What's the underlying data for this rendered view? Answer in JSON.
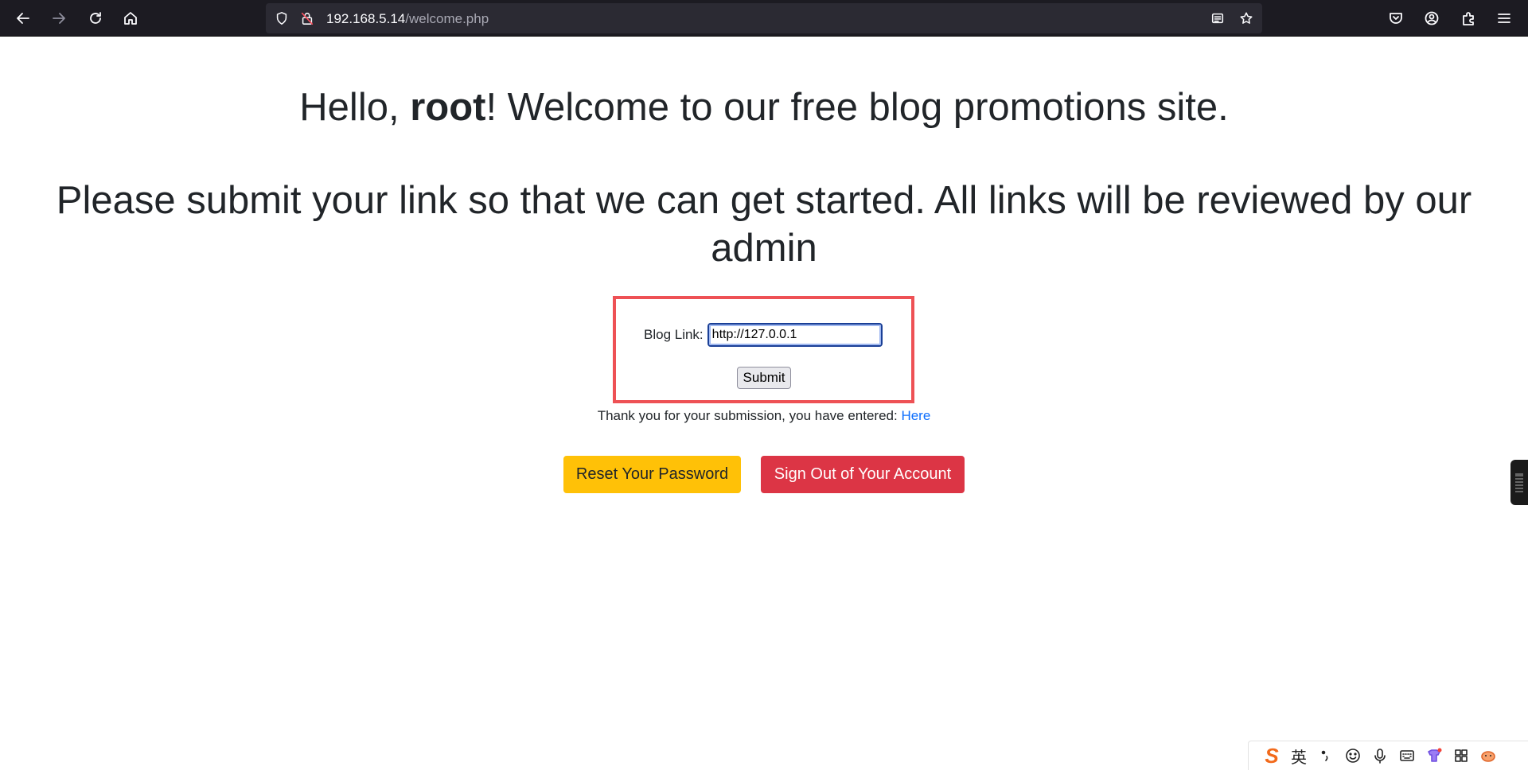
{
  "browser": {
    "url_host": "192.168.5.14",
    "url_path": "/welcome.php",
    "icons": [
      "back-arrow-icon",
      "forward-arrow-icon",
      "reload-icon",
      "home-icon",
      "shield-icon",
      "insecure-lock-icon",
      "reader-view-icon",
      "bookmark-star-icon",
      "pocket-icon",
      "account-icon",
      "extensions-icon",
      "menu-icon"
    ]
  },
  "page": {
    "greeting_prefix": "Hello, ",
    "username": "root",
    "greeting_suffix": "! Welcome to our free blog promotions site.",
    "instructions": "Please submit your link so that we can get started. All links will be reviewed by our admin",
    "form": {
      "label": "Blog Link:",
      "input_value": "http://127.0.0.1",
      "submit_label": "Submit"
    },
    "thanks_text": "Thank you for your submission, you have entered: ",
    "thanks_link": "Here",
    "reset_button": "Reset Your Password",
    "signout_button": "Sign Out of Your Account"
  },
  "ime": {
    "mode": "英",
    "icons": [
      "sogou-logo-icon",
      "mode-label",
      "punctuation-icon",
      "emoji-icon",
      "microphone-icon",
      "keyboard-icon",
      "skin-icon",
      "grid-icon",
      "assistant-icon"
    ]
  },
  "colors": {
    "highlight_border": "#ee5155",
    "reset_button_bg": "#ffc107",
    "signout_button_bg": "#dc3545",
    "link": "#0d6efd",
    "toolbar_bg": "#1c1b22"
  }
}
